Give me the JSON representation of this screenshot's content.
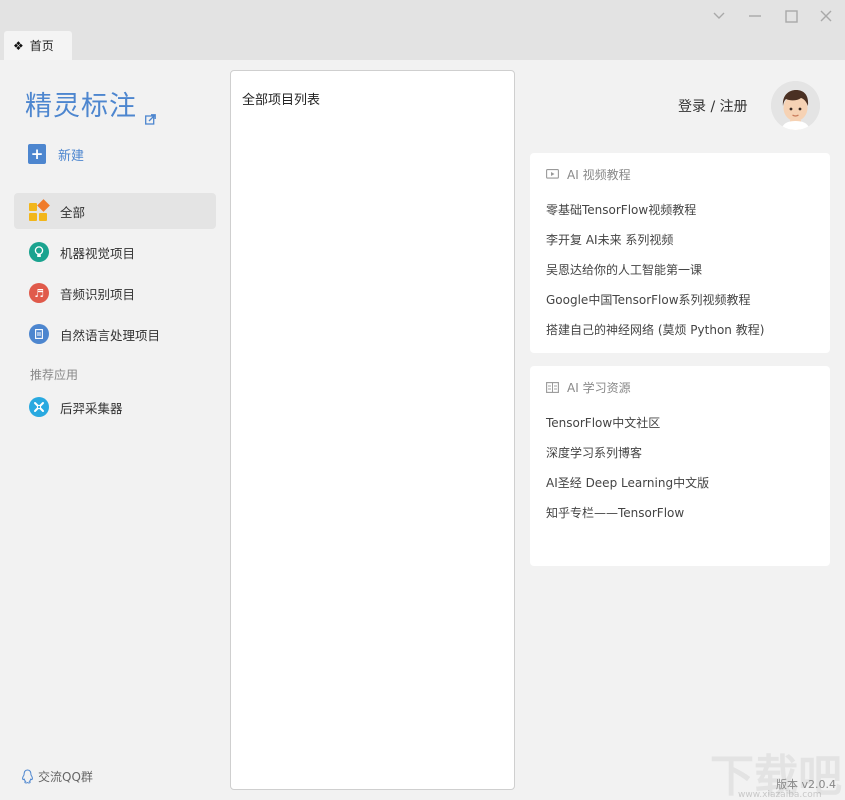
{
  "window": {
    "tab_label": "首页",
    "tab_icon": "app-grid-icon"
  },
  "sidebar": {
    "brand": "精灵标注",
    "new_label": "新建",
    "items": [
      {
        "label": "全部",
        "icon": "all-projects-icon",
        "active": true
      },
      {
        "label": "机器视觉项目",
        "icon": "bulb-icon",
        "color": "#1aa38f"
      },
      {
        "label": "音频识别项目",
        "icon": "music-icon",
        "color": "#e05a4b"
      },
      {
        "label": "自然语言处理项目",
        "icon": "document-icon",
        "color": "#4d86cf"
      }
    ],
    "section_label": "推荐应用",
    "apps": [
      {
        "label": "后羿采集器",
        "icon": "collector-icon",
        "color": "#29a9e0"
      }
    ],
    "qq_label": "交流QQ群"
  },
  "main": {
    "list_title": "全部项目列表"
  },
  "header": {
    "login_label": "登录 / 注册"
  },
  "video_card": {
    "title": "AI 视频教程",
    "links": [
      "零基础TensorFlow视频教程",
      "李开复 AI未来 系列视频",
      "吴恩达给你的人工智能第一课",
      "Google中国TensorFlow系列视频教程",
      "搭建自己的神经网络 (莫烦 Python 教程)"
    ]
  },
  "resource_card": {
    "title": "AI 学习资源",
    "links": [
      "TensorFlow中文社区",
      "深度学习系列博客",
      "AI圣经 Deep Learning中文版",
      "知乎专栏——TensorFlow"
    ]
  },
  "footer": {
    "version": "版本 v2.0.4",
    "watermark": "下载吧",
    "watermark_url": "www.xiazaiba.com"
  },
  "colors": {
    "accent": "#4d86cf",
    "background": "#f2f2f2",
    "titlebar": "#e3e3e3"
  }
}
